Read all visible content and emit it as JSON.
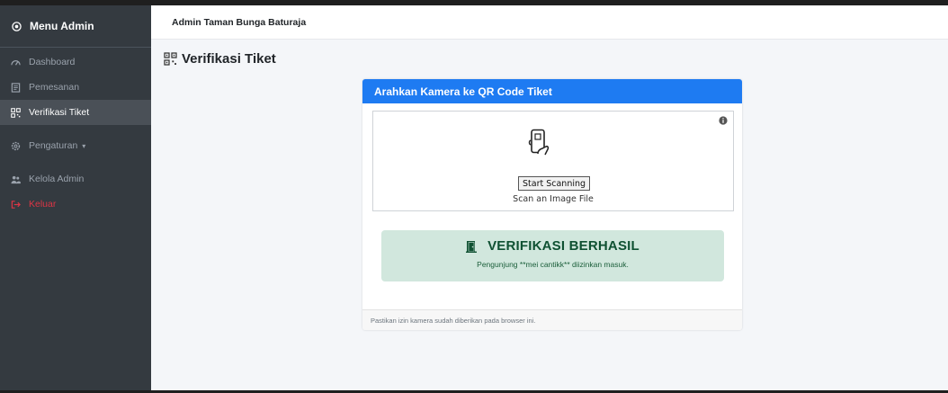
{
  "sidebar": {
    "brand": "Menu Admin",
    "items": [
      {
        "label": "Dashboard",
        "icon": "dashboard-icon"
      },
      {
        "label": "Pemesanan",
        "icon": "receipt-icon"
      },
      {
        "label": "Verifikasi Tiket",
        "icon": "qr-code-icon",
        "active": true
      },
      {
        "label": "Pengaturan",
        "icon": "gear-icon",
        "caret": "▾"
      },
      {
        "label": "Kelola Admin",
        "icon": "users-icon"
      },
      {
        "label": "Keluar",
        "icon": "logout-icon"
      }
    ]
  },
  "header": {
    "title": "Admin Taman Bunga Baturaja"
  },
  "page": {
    "title": "Verifikasi Tiket"
  },
  "card": {
    "header": "Arahkan Kamera ke QR Code Tiket",
    "scanner": {
      "start_button": "Start Scanning",
      "scan_file_link": "Scan an Image File"
    },
    "alert": {
      "title": "VERIFIKASI BERHASIL",
      "message": "Pengunjung **mei cantikk** diizinkan masuk."
    },
    "footer": "Pastikan izin kamera sudah diberikan pada browser ini."
  },
  "colors": {
    "sidebar_bg": "#343a40",
    "active_bg": "#4a5057",
    "primary": "#1e7bf2",
    "success_bg": "#d1e7dd",
    "success_text": "#0f5132",
    "danger": "#dc3545"
  }
}
